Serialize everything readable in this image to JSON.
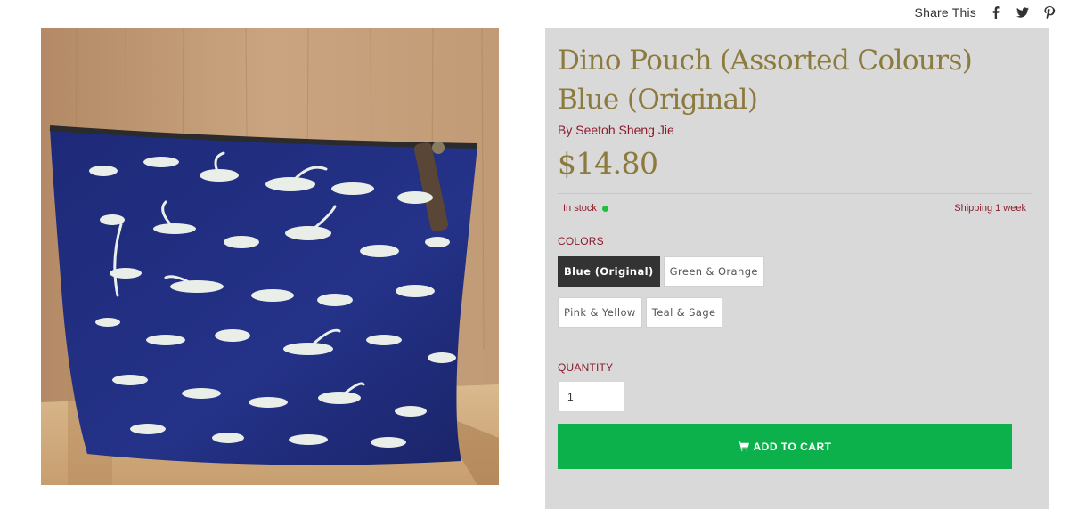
{
  "share": {
    "label": "Share This",
    "icons": [
      "facebook-icon",
      "twitter-icon",
      "pinterest-icon"
    ]
  },
  "product": {
    "image_description": "",
    "title_line1": "Dino Pouch (Assorted Colours)",
    "title_line2": "Blue (Original)",
    "author": "By Seetoh Sheng Jie",
    "price": "$14.80",
    "stock_status": "In stock",
    "shipping": "Shipping 1 week"
  },
  "colors": {
    "label": "COLORS",
    "options": [
      "Blue (Original)",
      "Green & Orange",
      "Pink & Yellow",
      "Teal & Sage"
    ],
    "selected": "Blue (Original)"
  },
  "quantity": {
    "label": "QUANTITY",
    "value": "1"
  },
  "cart": {
    "label": "ADD TO CART",
    "icon": "shopping-cart-icon"
  },
  "theme": {
    "accent": "#0db14b",
    "title_color": "#8d7a3e",
    "text_accent": "#8b1c2c",
    "panel_bg": "#d9d9d9",
    "stock_dot": "#19c23a"
  }
}
